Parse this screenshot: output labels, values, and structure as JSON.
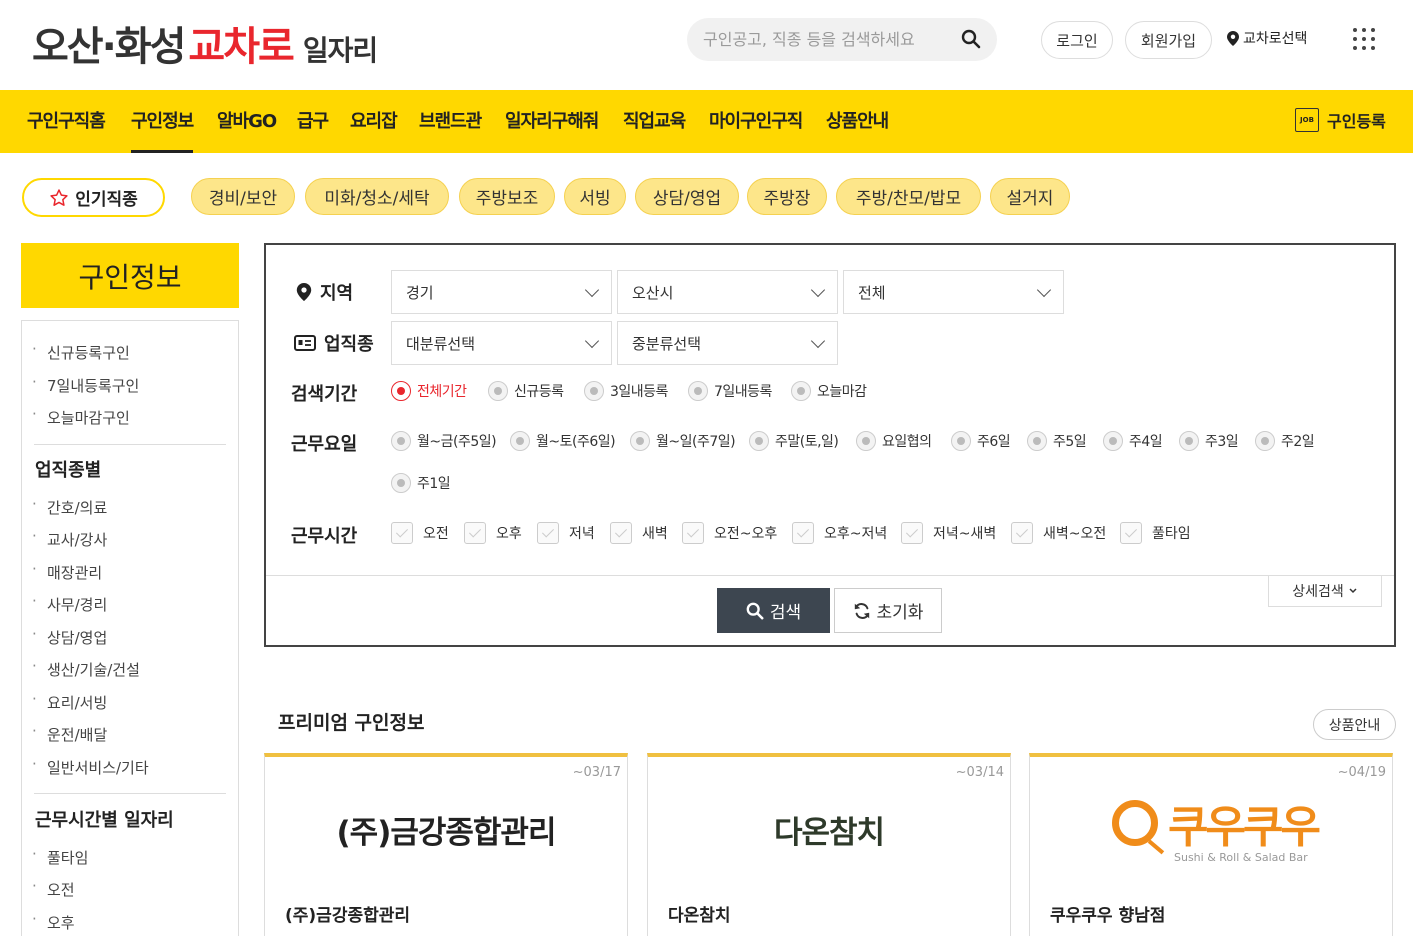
{
  "header": {
    "logo_main": "오산·화성",
    "logo_accent": "교차로",
    "logo_sub": "일자리",
    "search_placeholder": "구인공고, 직종 등을 검색하세요",
    "login": "로그인",
    "signup": "회원가입",
    "region_select": "교차로선택"
  },
  "nav": {
    "items": [
      "구인구직홈",
      "구인정보",
      "알바GO",
      "급구",
      "요리잡",
      "브랜드관",
      "일자리구해줘",
      "직업교육",
      "마이구인구직",
      "상품안내"
    ],
    "active": "구인정보",
    "register": "구인등록",
    "register_icon_text": "JOB"
  },
  "popular": {
    "label": "인기직종",
    "chips": [
      "경비/보안",
      "미화/청소/세탁",
      "주방보조",
      "서빙",
      "상담/영업",
      "주방장",
      "주방/찬모/밥모",
      "설거지"
    ]
  },
  "sidebar": {
    "title": "구인정보",
    "links_top": [
      "신규등록구인",
      "7일내등록구인",
      "오늘마감구인"
    ],
    "section1": "업직종별",
    "links_job": [
      "간호/의료",
      "교사/강사",
      "매장관리",
      "사무/경리",
      "상담/영업",
      "생산/기술/건설",
      "요리/서빙",
      "운전/배달",
      "일반서비스/기타"
    ],
    "section2": "근무시간별 일자리",
    "links_time": [
      "풀타임",
      "오전",
      "오후"
    ]
  },
  "search": {
    "region_label": "지역",
    "region_values": [
      "경기",
      "오산시",
      "전체"
    ],
    "job_label": "업직종",
    "job_values": [
      "대분류선택",
      "중분류선택"
    ],
    "period_label": "검색기간",
    "period_options": [
      "전체기간",
      "신규등록",
      "3일내등록",
      "7일내등록",
      "오늘마감"
    ],
    "period_selected": "전체기간",
    "days_label": "근무요일",
    "days_options": [
      "월~금(주5일)",
      "월~토(주6일)",
      "월~일(주7일)",
      "주말(토,일)",
      "요일협의",
      "주6일",
      "주5일",
      "주4일",
      "주3일",
      "주2일",
      "주1일"
    ],
    "time_label": "근무시간",
    "time_options": [
      "오전",
      "오후",
      "저녁",
      "새벽",
      "오전~오후",
      "오후~저녁",
      "저녁~새벽",
      "새벽~오전",
      "풀타임"
    ],
    "detail": "상세검색",
    "search_btn": "검색",
    "reset_btn": "초기화"
  },
  "premium": {
    "title": "프리미엄 구인정보",
    "guide": "상품안내",
    "cards": [
      {
        "date": "~03/17",
        "logo": "(주)금강종합관리",
        "name": "(주)금강종합관리"
      },
      {
        "date": "~03/14",
        "logo": "다온참치",
        "name": "다온참치"
      },
      {
        "date": "~04/19",
        "logo": "쿠우쿠우",
        "logo_sub": "Sushi & Roll & Salad Bar",
        "name": "쿠우쿠우 향남점"
      }
    ]
  },
  "colors": {
    "brand_yellow": "#ffd800",
    "accent_red": "#e9262d",
    "dark_button": "#3d4650",
    "chip_bg": "#fde68a",
    "kk_orange": "#f08c1a"
  }
}
